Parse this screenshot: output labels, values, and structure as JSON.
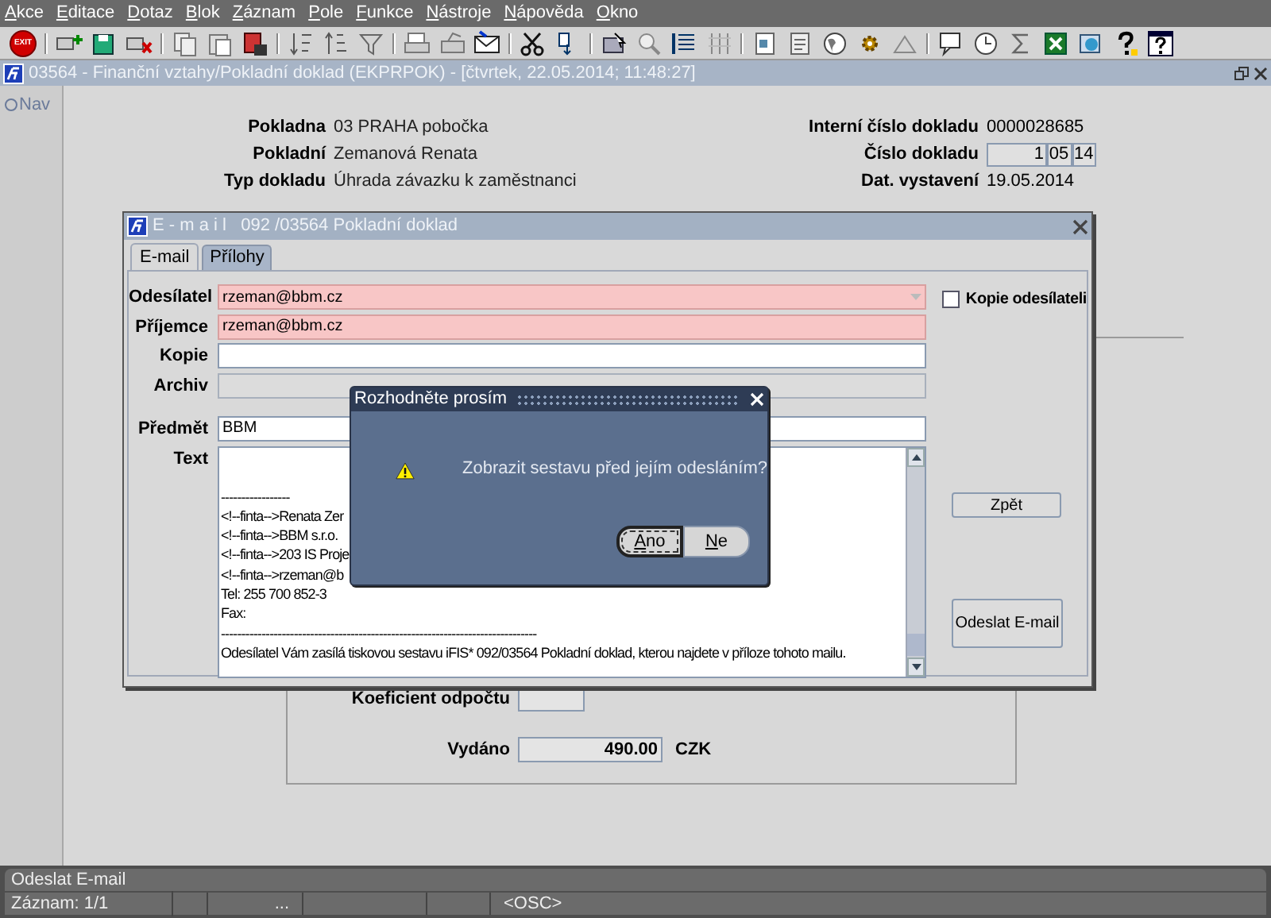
{
  "menu": [
    "Akce",
    "Editace",
    "Dotaz",
    "Blok",
    "Záznam",
    "Pole",
    "Funkce",
    "Nástroje",
    "Nápověda",
    "Okno"
  ],
  "toolbar": {
    "exit_label": "EXIT"
  },
  "window": {
    "title": "03564 - Finanční vztahy/Pokladní doklad (EKPRPOK) - [čtvrtek, 22.05.2014; 11:48:27]"
  },
  "nav": {
    "label": "Nav"
  },
  "form": {
    "left": [
      {
        "label": "Pokladna",
        "value": "03 PRAHA pobočka"
      },
      {
        "label": "Pokladní",
        "value": "Zemanová Renata"
      },
      {
        "label": "Typ dokladu",
        "value": "Úhrada závazku k zaměstnanci"
      }
    ],
    "internal_number": {
      "label": "Interní číslo dokladu",
      "value": "0000028685"
    },
    "document_number": {
      "label": "Číslo dokladu",
      "parts": [
        "1",
        "05",
        "14"
      ]
    },
    "issue_date": {
      "label": "Dat. vystavení",
      "value": "19.05.2014"
    },
    "coefficient": {
      "label": "Koeficient odpočtu"
    },
    "issued": {
      "label": "Vydáno",
      "value": "490.00",
      "currency": "CZK"
    }
  },
  "email_dialog": {
    "title": "E - m a i l   092 /03564 Pokladní doklad",
    "tabs": [
      {
        "label": "E-mail",
        "selected": true
      },
      {
        "label": "Přílohy",
        "selected": false
      }
    ],
    "fields": [
      {
        "label": "Odesílatel",
        "value": "rzeman@bbm.cz",
        "kind": "required",
        "dropdown": true
      },
      {
        "label": "Příjemce",
        "value": "rzeman@bbm.cz",
        "kind": "required",
        "dropdown": false
      },
      {
        "label": "Kopie",
        "kind": "normal",
        "dropdown": false
      },
      {
        "label": "Archiv",
        "kind": "readonly",
        "dropdown": false
      }
    ],
    "copy_sender": {
      "label": "Kopie odesílateli",
      "checked": false
    },
    "subject": {
      "label": "Předmět",
      "value": "BBM"
    },
    "text": {
      "label": "Text",
      "lines": [
        "-----------------",
        "<!--finta-->Renata Zer",
        "<!--finta-->BBM s.r.o.",
        "<!--finta-->203 IS Proje",
        "<!--finta-->rzeman@b",
        "Tel: 255 700 852-3",
        "Fax:",
        "------------------------------------------------------------------------------",
        "Odesílatel Vám zasílá tiskovou sestavu iFIS* 092/03564 Pokladní doklad, kterou najdete v příloze tohoto mailu."
      ]
    },
    "buttons": [
      {
        "label": "Zpět",
        "kind": "small"
      },
      {
        "label": "Odeslat E-mail",
        "kind": "large"
      }
    ]
  },
  "confirm": {
    "title": "Rozhodněte prosím",
    "message": "Zobrazit sestavu před jejím odesláním?",
    "buttons": [
      {
        "label": "Ano",
        "selected": true
      },
      {
        "label": "Ne",
        "selected": false
      }
    ]
  },
  "status": {
    "message": "Odeslat E-mail",
    "record": "Záznam: 1/1",
    "ellipsis": "...",
    "mode": "<OSC>"
  }
}
